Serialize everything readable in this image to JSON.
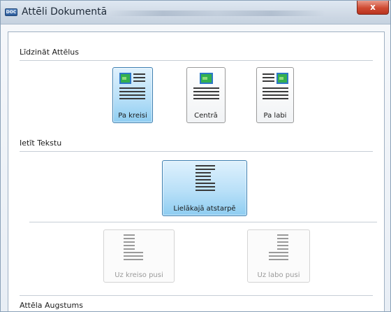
{
  "window": {
    "title": "Attēli Dokumentā",
    "icon_text": "DOC",
    "close_label": "x"
  },
  "align_section": {
    "title": "Līdzināt Attēlus",
    "options": [
      {
        "label": "Pa kreisi",
        "icon": "image-left-icon",
        "selected": true
      },
      {
        "label": "Centrā",
        "icon": "image-center-icon",
        "selected": false
      },
      {
        "label": "Pa labi",
        "icon": "image-right-icon",
        "selected": false
      }
    ]
  },
  "wrap_section": {
    "title": "Ietīt Tekstu",
    "options": [
      {
        "label": "Lielākajā atstarpē",
        "icon": "text-wrap-largest-icon",
        "selected": true,
        "enabled": true
      },
      {
        "label": "Uz kreiso pusi",
        "icon": "text-wrap-left-icon",
        "selected": false,
        "enabled": false
      },
      {
        "label": "Uz labo pusi",
        "icon": "text-wrap-right-icon",
        "selected": false,
        "enabled": false
      }
    ]
  },
  "height_section": {
    "title": "Attēla Augstums"
  },
  "colors": {
    "selected_tile": "#b9e0f8",
    "selected_border": "#3c7fb1",
    "image_green": "#2fa64a",
    "image_frame": "#2c78c6",
    "close_red": "#cf4a32"
  }
}
